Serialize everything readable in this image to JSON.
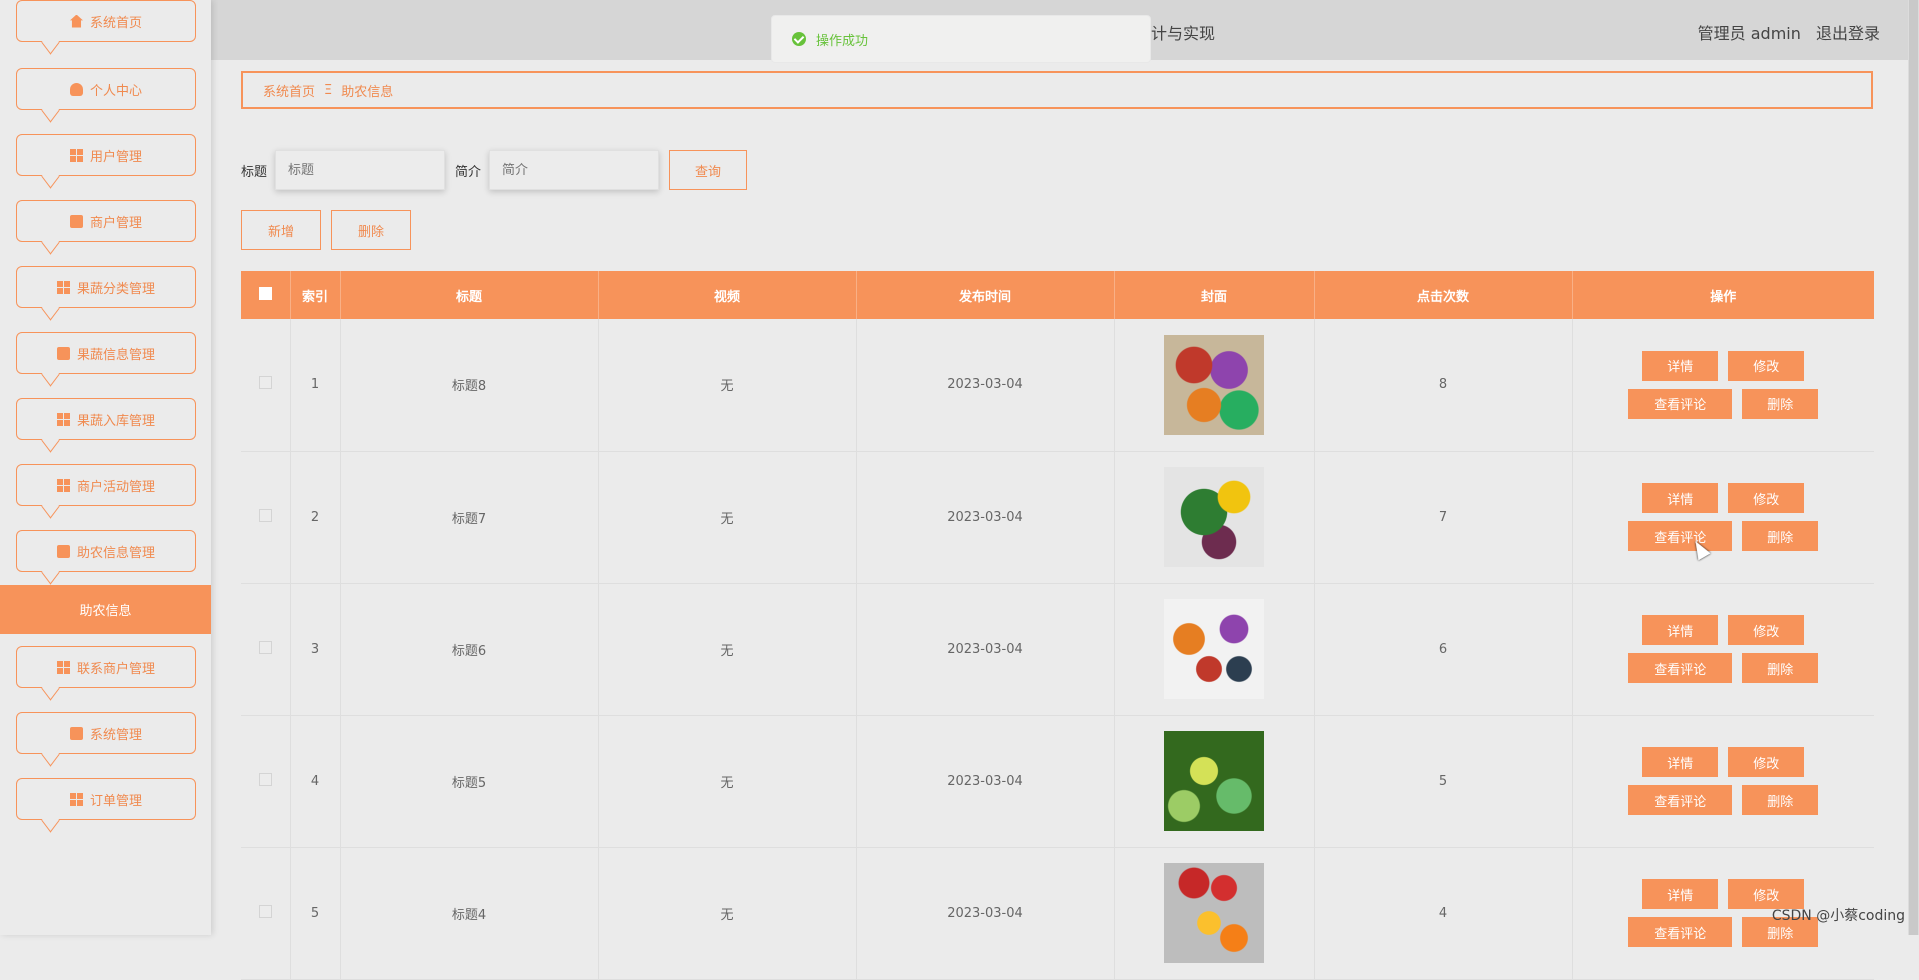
{
  "header": {
    "title": "果蔬种植销售一体化服务平台的设计与实现",
    "role": "管理员 admin",
    "logout": "退出登录"
  },
  "toast": {
    "message": "操作成功"
  },
  "sidebar": {
    "items": [
      {
        "label": "系统首页",
        "icon": "home-icon"
      },
      {
        "label": "个人中心",
        "icon": "user-icon"
      },
      {
        "label": "用户管理",
        "icon": "grid-icon"
      },
      {
        "label": "商户管理",
        "icon": "briefcase-icon"
      },
      {
        "label": "果蔬分类管理",
        "icon": "grid-icon"
      },
      {
        "label": "果蔬信息管理",
        "icon": "clipboard-icon"
      },
      {
        "label": "果蔬入库管理",
        "icon": "table-icon"
      },
      {
        "label": "商户活动管理",
        "icon": "grid-icon"
      },
      {
        "label": "助农信息管理",
        "icon": "chat-icon"
      },
      {
        "label": "联系商户管理",
        "icon": "grid-icon"
      },
      {
        "label": "系统管理",
        "icon": "wallet-icon"
      },
      {
        "label": "订单管理",
        "icon": "grid-icon"
      }
    ],
    "active": "助农信息"
  },
  "breadcrumb": {
    "home": "系统首页",
    "sep": "Ξ",
    "current": "助农信息"
  },
  "search": {
    "title_label": "标题",
    "title_placeholder": "标题",
    "intro_label": "简介",
    "intro_placeholder": "简介",
    "query": "查询"
  },
  "toolbar": {
    "add": "新增",
    "delete": "删除"
  },
  "table": {
    "headers": [
      "索引",
      "标题",
      "视频",
      "发布时间",
      "封面",
      "点击次数",
      "操作"
    ],
    "rows": [
      {
        "index": "1",
        "title": "标题8",
        "video": "无",
        "date": "2023-03-04",
        "clicks": "8"
      },
      {
        "index": "2",
        "title": "标题7",
        "video": "无",
        "date": "2023-03-04",
        "clicks": "7"
      },
      {
        "index": "3",
        "title": "标题6",
        "video": "无",
        "date": "2023-03-04",
        "clicks": "6"
      },
      {
        "index": "4",
        "title": "标题5",
        "video": "无",
        "date": "2023-03-04",
        "clicks": "5"
      },
      {
        "index": "5",
        "title": "标题4",
        "video": "无",
        "date": "2023-03-04",
        "clicks": "4"
      }
    ],
    "ops": {
      "detail": "详情",
      "edit": "修改",
      "comments": "查看评论",
      "delete": "删除"
    }
  },
  "watermark": "CSDN @小蔡coding",
  "colors": {
    "accent": "#f7935a",
    "success": "#67c23a"
  }
}
